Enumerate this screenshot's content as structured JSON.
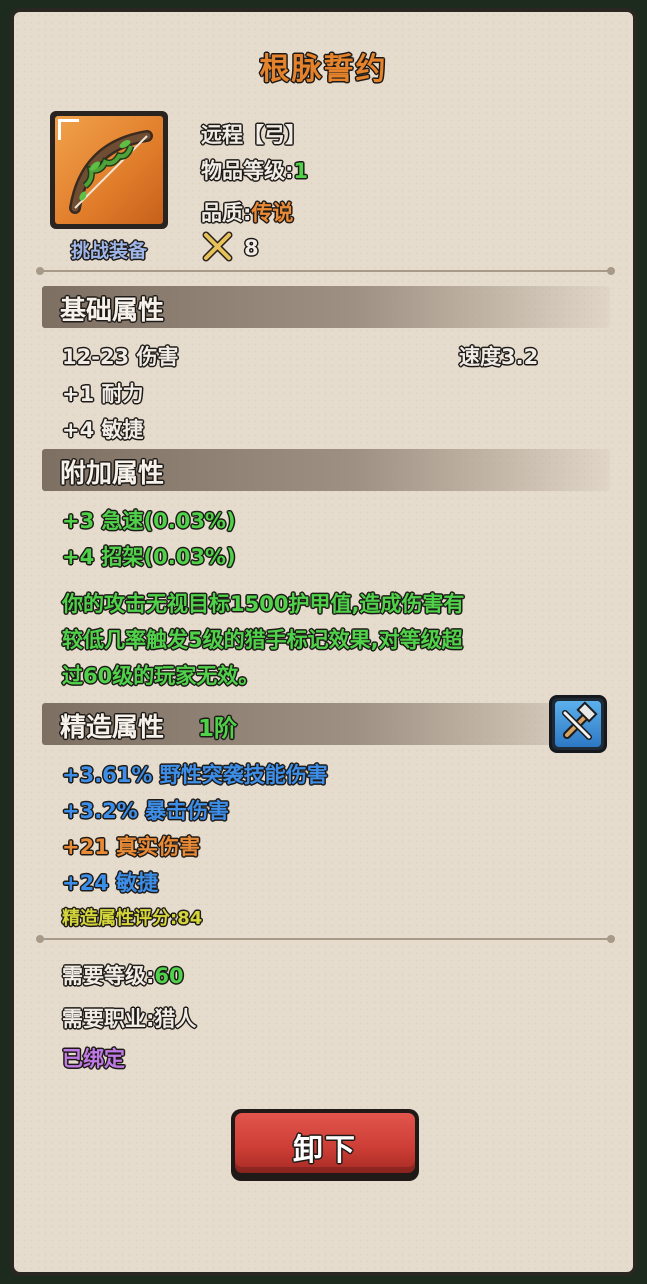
{
  "item": {
    "name": "根脉誓约",
    "type": "远程【弓】",
    "item_level_label": "物品等级:",
    "item_level_value": "1",
    "quality_label": "品质:",
    "quality_value": "传说",
    "source_tag": "挑战装备",
    "sword_count": "8"
  },
  "base": {
    "title": "基础属性",
    "damage": "12-23 伤害",
    "speed": "速度3.2",
    "stats": [
      "+1 耐力",
      "+4 敏捷"
    ]
  },
  "bonus": {
    "title": "附加属性",
    "stats": [
      "+3 急速(0.03%)",
      "+4 招架(0.03%)"
    ],
    "description_lines": [
      "你的攻击无视目标1500护甲值,造成伤害有",
      "较低几率触发5级的猎手标记效果,对等级超",
      "过60级的玩家无效。"
    ]
  },
  "forged": {
    "title": "精造属性",
    "tier": "1阶",
    "stats": [
      {
        "text": "+3.61% 野性突袭技能伤害",
        "color": "blue"
      },
      {
        "text": "+3.2% 暴击伤害",
        "color": "blue"
      },
      {
        "text": "+21 真实伤害",
        "color": "orange"
      },
      {
        "text": "+24 敏捷",
        "color": "blue"
      }
    ],
    "score": "精造属性评分:84"
  },
  "requirements": {
    "level_label": "需要等级:",
    "level_value": "60",
    "class_label": "需要职业:",
    "class_value": "猎人",
    "bound": "已绑定"
  },
  "actions": {
    "unequip_label": "卸下"
  },
  "icons": {
    "weapon": "bow-icon",
    "power": "crossed-swords-icon",
    "forge": "hammer-icon"
  },
  "colors": {
    "title": "#e4832b",
    "green": "#4fd24a",
    "blue": "#3c8ee8",
    "orange": "#e98a36",
    "purple": "#c07ae6",
    "button": "#cb3d35"
  }
}
